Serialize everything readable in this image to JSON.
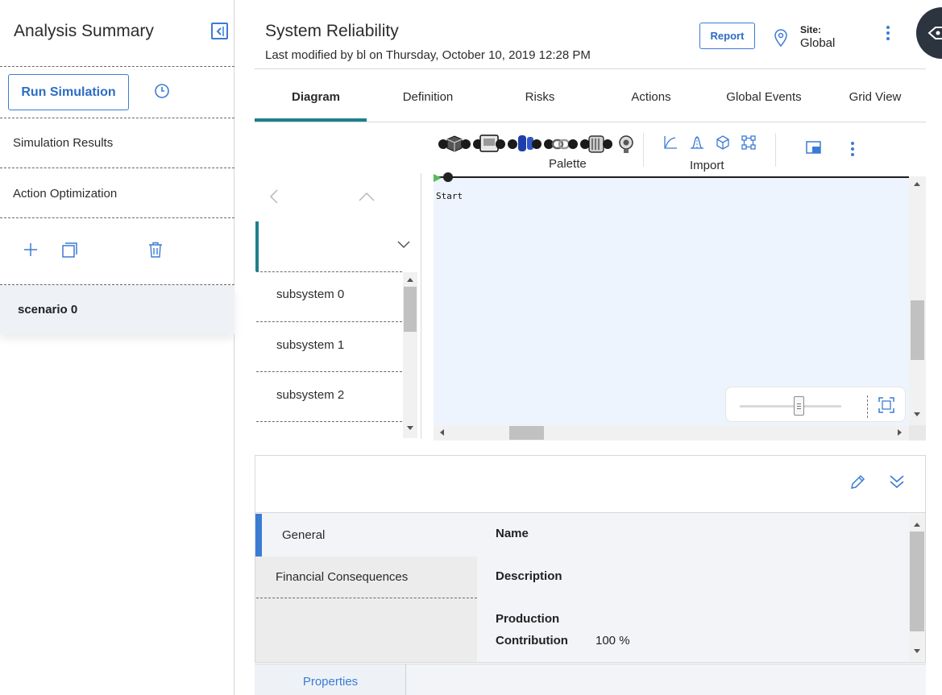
{
  "left_pane": {
    "title": "Analysis Summary",
    "run_simulation_label": "Run Simulation",
    "items": [
      {
        "label": "Simulation Results"
      },
      {
        "label": "Action Optimization"
      }
    ],
    "scenario_label": "scenario 0"
  },
  "header": {
    "title": "System Reliability",
    "subtitle": "Last modified by bl on Thursday, October 10, 2019 12:28 PM",
    "report_label": "Report",
    "site_label": "Site:",
    "site_value": "Global"
  },
  "tabs": [
    {
      "label": "Diagram",
      "active": true
    },
    {
      "label": "Definition",
      "active": false
    },
    {
      "label": "Risks",
      "active": false
    },
    {
      "label": "Actions",
      "active": false
    },
    {
      "label": "Global Events",
      "active": false
    },
    {
      "label": "Grid View",
      "active": false
    }
  ],
  "toolbar": {
    "palette_label": "Palette",
    "import_label": "Import"
  },
  "tree": {
    "items": [
      {
        "label": "subsystem 0"
      },
      {
        "label": "subsystem 1"
      },
      {
        "label": "subsystem 2"
      }
    ]
  },
  "canvas": {
    "start_label": "Start"
  },
  "details": {
    "tabs": [
      {
        "label": "General",
        "active": true
      },
      {
        "label": "Financial Consequences",
        "active": false
      }
    ],
    "fields": {
      "name_label": "Name",
      "description_label": "Description",
      "production_label": "Production",
      "contribution_label": "Contribution",
      "contribution_value": "100 %"
    },
    "properties_label": "Properties"
  },
  "colors": {
    "accent_blue": "#3b7bd4",
    "teal": "#1f7f8c",
    "canvas_bg": "#eef4fd"
  }
}
